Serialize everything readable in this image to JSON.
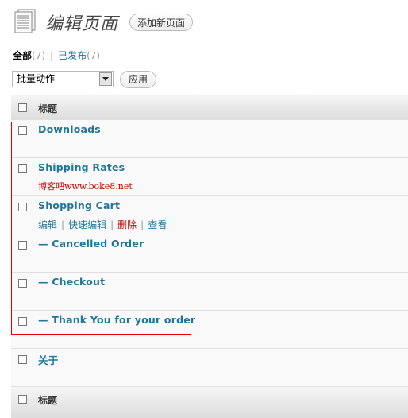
{
  "header": {
    "title": "编辑页面",
    "add_button": "添加新页面"
  },
  "filters": {
    "all_label": "全部",
    "all_count": "(7)",
    "separator": "|",
    "published_label": "已发布",
    "published_count": "(7)"
  },
  "bulk": {
    "select_value": "批量动作",
    "apply_label": "应用"
  },
  "table": {
    "header_label": "标题",
    "footer_label": "标题",
    "rows": [
      {
        "title": "Downloads"
      },
      {
        "title": "Shipping Rates",
        "watermark": "博客吧www.boke8.net"
      },
      {
        "title": "Shopping Cart",
        "actions": [
          "编辑",
          "快速编辑",
          "删除",
          "查看"
        ],
        "action_separator": "|"
      },
      {
        "title": "— Cancelled Order"
      },
      {
        "title": "— Checkout"
      },
      {
        "title": "— Thank You for your order"
      },
      {
        "title": "关于"
      }
    ]
  },
  "colors": {
    "link": "#21759b",
    "delete": "#bc0b0b",
    "highlight_box": "#e00000",
    "watermark": "#cc0000"
  },
  "icons": {
    "page_icon": "document-pages-icon",
    "select_arrow": "chevron-down-icon",
    "checkbox": "checkbox-icon"
  }
}
